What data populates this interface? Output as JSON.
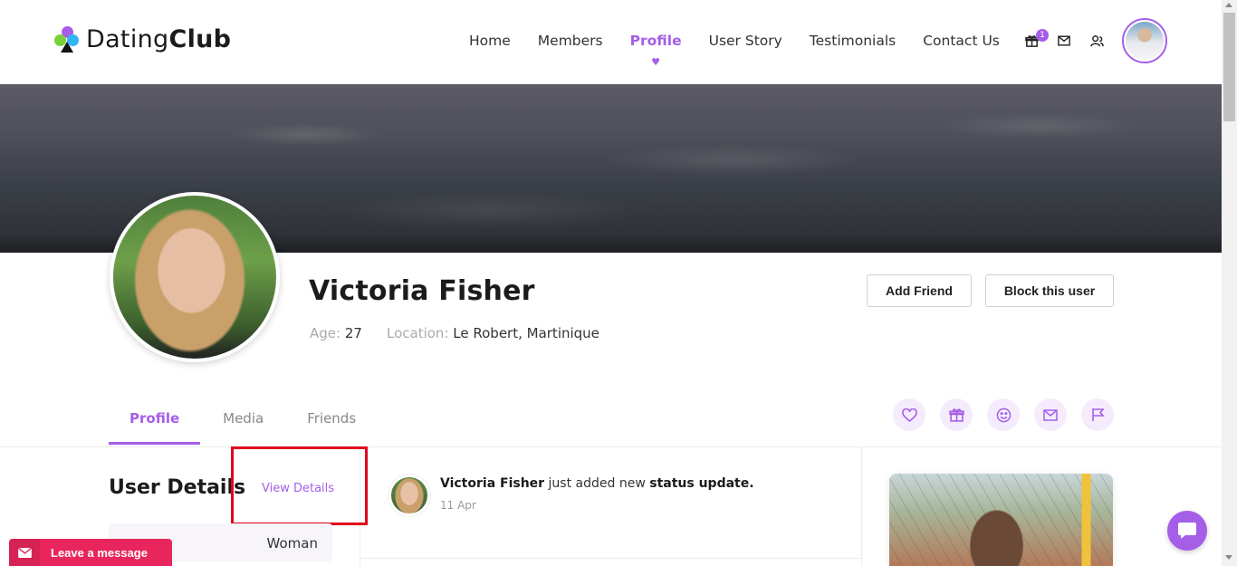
{
  "brand": {
    "name_light": "Dating",
    "name_bold": "Club",
    "colors": {
      "accent": "#a55ee8",
      "red": "#e8265d"
    }
  },
  "nav": {
    "items": [
      {
        "label": "Home",
        "active": false
      },
      {
        "label": "Members",
        "active": false
      },
      {
        "label": "Profile",
        "active": true
      },
      {
        "label": "User Story",
        "active": false
      },
      {
        "label": "Testimonials",
        "active": false
      },
      {
        "label": "Contact Us",
        "active": false
      }
    ],
    "gift_badge": "1",
    "icons": [
      "gift-icon",
      "mail-icon",
      "users-icon"
    ]
  },
  "profile": {
    "name": "Victoria Fisher",
    "age_label": "Age:",
    "age": "27",
    "location_label": "Location:",
    "location": "Le Robert, Martinique",
    "add_friend": "Add Friend",
    "block_user": "Block this user"
  },
  "tabs": [
    {
      "label": "Profile",
      "active": true
    },
    {
      "label": "Media",
      "active": false
    },
    {
      "label": "Friends",
      "active": false
    }
  ],
  "actions": [
    "heart-icon",
    "gift-icon",
    "smile-icon",
    "mail-icon",
    "flag-icon"
  ],
  "user_details": {
    "title": "User Details",
    "view_details": "View Details",
    "gender": "Woman"
  },
  "feed": {
    "author": "Victoria Fisher",
    "text": "just added new",
    "emphasis": "status update.",
    "date": "11 Apr"
  },
  "widget": {
    "leave_message": "Leave a message"
  }
}
